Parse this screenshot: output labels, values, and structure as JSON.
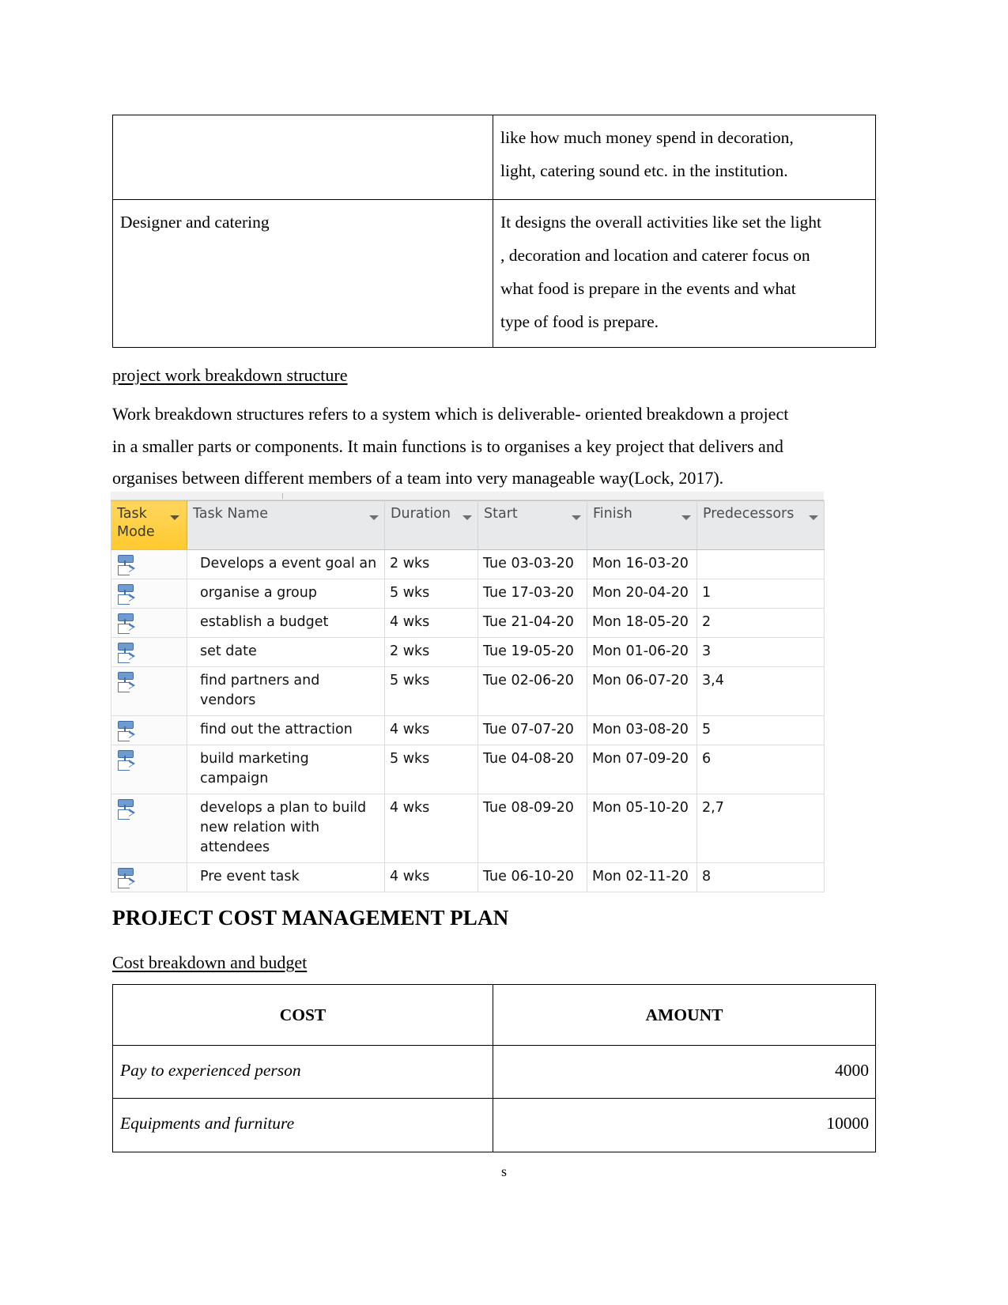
{
  "document": {
    "footer_text": "s"
  },
  "top_table": {
    "rows": [
      {
        "left": "",
        "right_lines": [
          "like how much money spend in decoration,",
          "light, catering sound etc. in the institution."
        ]
      },
      {
        "left": "Designer and catering",
        "right_lines": [
          "It designs the overall activities like set the light",
          ", decoration and location and caterer focus on",
          "what food is prepare in the events and what",
          "type of food is prepare."
        ]
      }
    ]
  },
  "wbs_section": {
    "heading": "project work breakdown structure",
    "paragraph_lines": [
      "Work breakdown structures refers to a system which is deliverable- oriented breakdown a project",
      "in a smaller parts or components. It main functions is to organises a key project that delivers and",
      "organises between different members of a team into very manageable way(Lock, 2017)."
    ]
  },
  "project_table": {
    "columns": [
      {
        "label": "Task Mode",
        "highlight": true,
        "filter_icon": "chevron-down-icon"
      },
      {
        "label": "Task Name",
        "highlight": false,
        "filter_icon": "chevron-down-icon"
      },
      {
        "label": "Duration",
        "highlight": false,
        "filter_icon": "chevron-down-icon"
      },
      {
        "label": "Start",
        "highlight": false,
        "filter_icon": "chevron-down-icon"
      },
      {
        "label": "Finish",
        "highlight": false,
        "filter_icon": "chevron-down-icon"
      },
      {
        "label": "Predecessors",
        "highlight": false,
        "filter_icon": "chevron-down-icon"
      }
    ],
    "header_colors": {
      "highlight": "#ffc92f",
      "normal": "#e7e9eb"
    },
    "rows": [
      {
        "mode_icon": "auto-schedule-icon",
        "name": "Develops a event goal an",
        "duration": "2 wks",
        "start": "Tue 03-03-20",
        "finish": "Mon 16-03-20",
        "predecessors": ""
      },
      {
        "mode_icon": "auto-schedule-icon",
        "name": "organise a group",
        "duration": "5 wks",
        "start": "Tue 17-03-20",
        "finish": "Mon 20-04-20",
        "predecessors": "1"
      },
      {
        "mode_icon": "auto-schedule-icon",
        "name": "establish a budget",
        "duration": "4 wks",
        "start": "Tue 21-04-20",
        "finish": "Mon 18-05-20",
        "predecessors": "2"
      },
      {
        "mode_icon": "auto-schedule-icon",
        "name": "set date",
        "duration": "2 wks",
        "start": "Tue 19-05-20",
        "finish": "Mon 01-06-20",
        "predecessors": "3"
      },
      {
        "mode_icon": "auto-schedule-icon",
        "name": "find partners and\nvendors",
        "duration": "5 wks",
        "start": "Tue 02-06-20",
        "finish": "Mon 06-07-20",
        "predecessors": "3,4"
      },
      {
        "mode_icon": "auto-schedule-icon",
        "name": "find out the attraction",
        "duration": "4 wks",
        "start": "Tue 07-07-20",
        "finish": "Mon 03-08-20",
        "predecessors": "5"
      },
      {
        "mode_icon": "auto-schedule-icon",
        "name": "build marketing\ncampaign",
        "duration": "5 wks",
        "start": "Tue 04-08-20",
        "finish": "Mon 07-09-20",
        "predecessors": "6"
      },
      {
        "mode_icon": "auto-schedule-icon",
        "name": "develops a plan to build\nnew relation with\nattendees",
        "duration": "4 wks",
        "start": "Tue 08-09-20",
        "finish": "Mon 05-10-20",
        "predecessors": "2,7"
      },
      {
        "mode_icon": "auto-schedule-icon",
        "name": "Pre event task",
        "duration": "4 wks",
        "start": "Tue 06-10-20",
        "finish": "Mon 02-11-20",
        "predecessors": "8"
      }
    ]
  },
  "cost_section": {
    "title": "PROJECT COST MANAGEMENT PLAN",
    "sub_heading": "Cost breakdown and budget ",
    "table": {
      "headers": [
        "COST",
        "AMOUNT"
      ],
      "rows": [
        {
          "cost": "Pay to experienced person",
          "amount": "4000"
        },
        {
          "cost": "Equipments and furniture",
          "amount": "10000"
        }
      ]
    }
  }
}
